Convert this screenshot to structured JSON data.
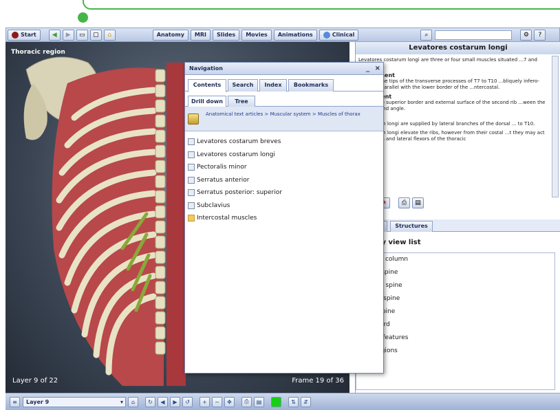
{
  "toolbar": {
    "start_label": "Start",
    "tabs": [
      "Anatomy",
      "MRI",
      "Slides",
      "Movies",
      "Animations",
      "Clinical"
    ]
  },
  "viewport": {
    "region_label": "Thoracic region",
    "layer_text": "Layer 9 of 22",
    "frame_text": "Frame 19 of 36"
  },
  "bottombar": {
    "layer_value": "Layer 9"
  },
  "navigation": {
    "title": "Navigation",
    "minimize_label": "_",
    "close_label": "×",
    "tabs": [
      "Contents",
      "Search",
      "Index",
      "Bookmarks"
    ],
    "subtabs": [
      "Drill down",
      "Tree"
    ],
    "breadcrumb": "Anatomical text articles > Muscular system > Muscles of thorax",
    "items": [
      "Levatores costarum breves",
      "Levatores costarum longi",
      "Pectoralis minor",
      "Serratus anterior",
      "Serratus posterior: superior",
      "Subclavius",
      "Intercostal muscles"
    ]
  },
  "article": {
    "title": "Levatores costarum longi",
    "intro": "Levatores costarum longi are three or four small muscles situated ...7 and T10.",
    "sections": [
      {
        "heading": "Attachment",
        "text": "...s from the tips of the transverse processes of T7 to T10 ...bliquely infero-laterally, parallel with the lower border of the ...ntercostal."
      },
      {
        "heading": "...achment",
        "text": "...ch to the superior border and external surface of the second rib ...ween the tubercle and angle."
      },
      {
        "heading": "...pply",
        "text": "...costarum longi are supplied by lateral branches of the dorsal ... to T10."
      },
      {
        "heading": "",
        "text": "...costarum longi elevate the ribs, however from their costal ...t they may act as rotators and lateral flexors of the thoracic"
      }
    ]
  },
  "right_tabs": [
    "...",
    "Structures"
  ],
  "view_list": {
    "title": "...tomy view list",
    "items": [
      "...tebral column",
      "...vical spine",
      "...oracic spine",
      "...mbar spine",
      "...cral spine",
      "...nal cord",
      "...rface features",
      "...ne regions"
    ]
  }
}
